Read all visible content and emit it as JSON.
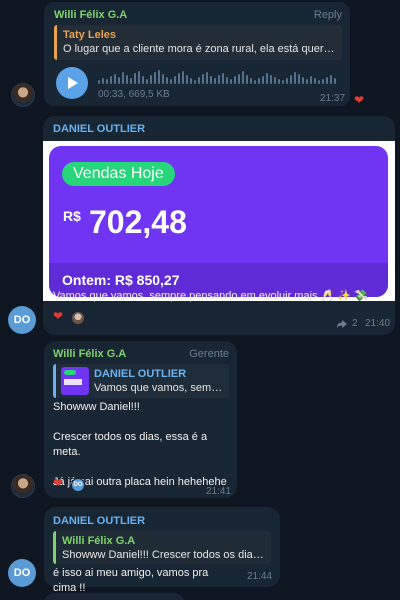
{
  "messages": [
    {
      "sender": "Willi Félix G.A",
      "action": "Reply",
      "reply_name": "Taty Leles",
      "reply_text": "O lugar que a cliente mora é zona rural, ela está queren...",
      "voice_meta": "00:33, 669,5 KB",
      "time": "21:37",
      "reaction": "❤"
    },
    {
      "sender": "DANIEL OUTLIER",
      "card": {
        "badge": "Vendas Hoje",
        "currency": "R$",
        "amount": "702,48",
        "yesterday": "Ontem: R$ 850,27"
      },
      "text": "Vamos que vamos, sempre pensando em evoluir mais 🥂 ✨ 💸",
      "reaction": "❤",
      "forward_count": "2",
      "time": "21:40",
      "avatar": "DO"
    },
    {
      "sender": "Willi Félix G.A",
      "role": "Gerente",
      "reply_name": "DANIEL OUTLIER",
      "reply_text": "Vamos que vamos, sempr...",
      "text": "Showww Daniel!!!\n\nCrescer todos os dias, essa é a meta.\n\nJá já sai outra placa hein hehehehe",
      "reaction": "❤",
      "reaction_avatar": "DO",
      "time": "21:41"
    },
    {
      "sender": "DANIEL OUTLIER",
      "reply_name": "Willi Félix G.A",
      "reply_text": "Showww Daniel!!!  Crescer todos os dias....",
      "text": "é isso ai meu amigo, vamos pra cima !!",
      "time": "21:44",
      "avatar": "DO"
    }
  ],
  "colors": {
    "background": "#0e1621",
    "bubble": "#182533",
    "accent_green": "#7fd36b",
    "accent_blue": "#6ab2f2",
    "card_purple": "#6a2ff0",
    "badge_green": "#27d67a"
  }
}
